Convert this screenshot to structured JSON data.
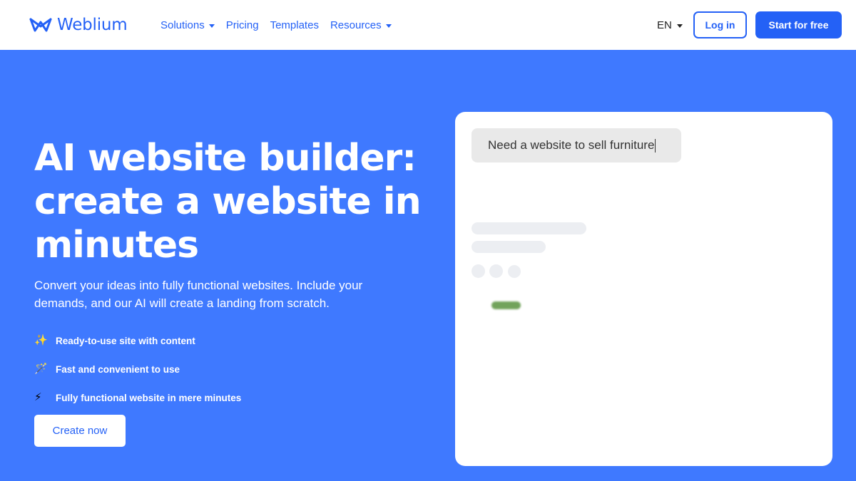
{
  "header": {
    "logo_text": "Weblium",
    "nav": [
      {
        "label": "Solutions",
        "has_dropdown": true
      },
      {
        "label": "Pricing",
        "has_dropdown": false
      },
      {
        "label": "Templates",
        "has_dropdown": false
      },
      {
        "label": "Resources",
        "has_dropdown": true
      }
    ],
    "language": "EN",
    "login_label": "Log in",
    "start_label": "Start for free"
  },
  "hero": {
    "title_lines": [
      "AI website builder:",
      "create a website in",
      "minutes"
    ],
    "subtitle": "Convert your ideas into fully functional websites. Include your demands, and our AI will create a landing from scratch.",
    "features": [
      {
        "icon": "sparkles-icon",
        "glyph": "✨",
        "label": "Ready-to-use site with content"
      },
      {
        "icon": "magic-wand-icon",
        "glyph": "🪄",
        "label": "Fast and convenient to use"
      },
      {
        "icon": "lightning-icon",
        "glyph": "⚡",
        "label": "Fully functional website in mere minutes"
      }
    ],
    "cta_label": "Create now"
  },
  "preview": {
    "prompt_text": "Need a website to sell furniture"
  },
  "colors": {
    "brand_blue": "#2461f6",
    "hero_background": "#3f79ff",
    "skeleton_gray": "#eceef2",
    "skeleton_green": "#72a35b"
  }
}
